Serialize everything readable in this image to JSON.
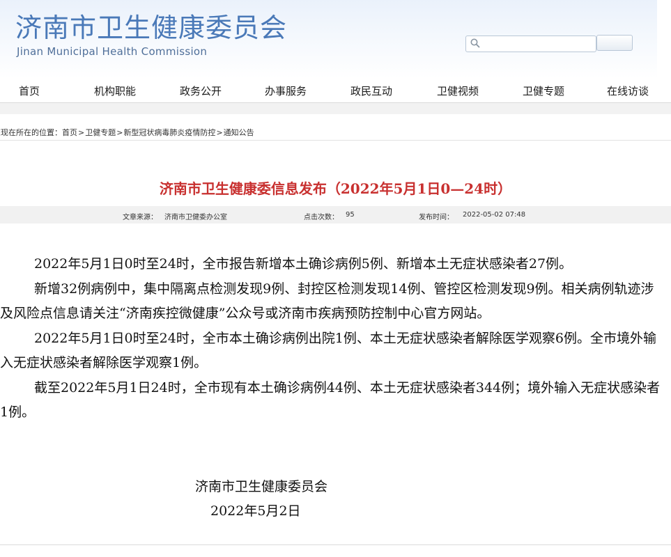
{
  "header": {
    "title": "济南市卫生健康委员会",
    "subtitle": "Jinan Municipal Health Commission",
    "search": {
      "placeholder": "",
      "button_label": ""
    }
  },
  "nav": {
    "items": [
      {
        "label": "首页"
      },
      {
        "label": "机构职能"
      },
      {
        "label": "政务公开"
      },
      {
        "label": "办事服务"
      },
      {
        "label": "政民互动"
      },
      {
        "label": "卫健视频"
      },
      {
        "label": "卫健专题"
      },
      {
        "label": "在线访谈"
      }
    ]
  },
  "breadcrumb": {
    "prefix": "您现在所在的位置：",
    "items": [
      "首页",
      "卫健专题",
      "新型冠状病毒肺炎疫情防控",
      "通知公告"
    ],
    "separator": ">"
  },
  "article": {
    "title": "济南市卫生健康委信息发布（2022年5月1日0—24时）",
    "meta": {
      "source_label": "文章来源：",
      "source_value": "济南市卫健委办公室",
      "clicks_label": "点击次数：",
      "clicks_value": "95",
      "date_label": "发布时间：",
      "date_value": "2022-05-02 07:48"
    },
    "paragraphs": [
      "2022年5月1日0时至24时，全市报告新增本土确诊病例5例、新增本土无症状感染者27例。",
      "新增32例病例中，集中隔离点检测发现9例、封控区检测发现14例、管控区检测发现9例。相关病例轨迹涉及风险点信息请关注“济南疾控微健康”公众号或济南市疾病预防控制中心官方网站。",
      "2022年5月1日0时至24时，全市本土确诊病例出院1例、本土无症状感染者解除医学观察6例。全市境外输入无症状感染者解除医学观察1例。",
      "截至2022年5月1日24时，全市现有本土确诊病例44例、本土无症状感染者344例；境外输入无症状感染者1例。"
    ],
    "signature": "济南市卫生健康委员会",
    "date": "2022年5月2日"
  }
}
